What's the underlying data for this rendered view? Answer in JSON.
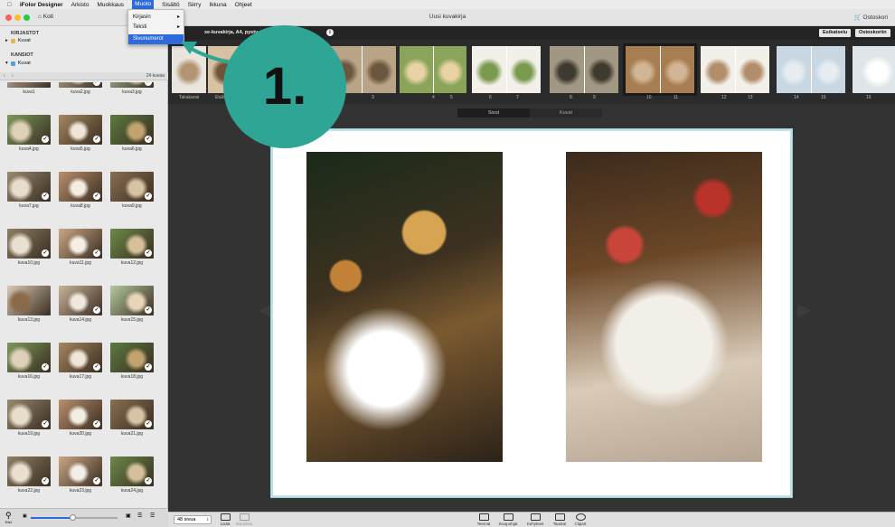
{
  "menubar": {
    "app": "iFolor Designer",
    "items": [
      "Arkisto",
      "Muokkaus",
      "Muoto",
      "Sisältö",
      "Siirry",
      "Ikkuna",
      "Ohjeet"
    ],
    "active": "Muoto"
  },
  "window": {
    "home": "Koti",
    "title": "Uusi kuvakirja",
    "cart": "Ostoskori"
  },
  "dropdown": {
    "items": [
      "Kirjasin",
      "Teksti",
      "Sivunumerot"
    ],
    "highlighted": "Sivunumerot"
  },
  "callout": {
    "label": "1.",
    "color": "#2ea595"
  },
  "sidebar": {
    "libraries_heading": "KIRJASTOT",
    "library_item": "Kuvat",
    "folders_heading": "KANSIOT",
    "folder_item": "Kuvat",
    "count": "24 kuvaa",
    "images": [
      "kuva1",
      "kuva2.jpg",
      "kuva3.jpg",
      "kuva4.jpg",
      "kuva5.jpg",
      "kuva6.jpg",
      "kuva7.jpg",
      "kuva8.jpg",
      "kuva9.jpg",
      "kuva10.jpg",
      "kuva11.jpg",
      "kuva12.jpg",
      "kuva13.jpg",
      "kuva14.jpg",
      "kuva15.jpg",
      "kuva16.jpg",
      "kuva17.jpg",
      "kuva18.jpg",
      "kuva19.jpg",
      "kuva20.jpg",
      "kuva21.jpg",
      "kuva22.jpg",
      "kuva23.jpg",
      "kuva24.jpg"
    ]
  },
  "topbar": {
    "book_info": "xe-kuvakirja, A4, pysty, sis",
    "preview_button": "Esikatselu",
    "cart_button": "Ostoskoriin"
  },
  "page_strip": {
    "labels": [
      "Takakansi",
      "Etuka",
      "3",
      "4",
      "5",
      "6",
      "7",
      "8",
      "9",
      "10",
      "11",
      "12",
      "13",
      "14",
      "15",
      "16"
    ]
  },
  "tabs": {
    "pages": "Sivut",
    "images": "Kuvat",
    "active": "Sivut"
  },
  "bottombar": {
    "page_count": "48 sivua",
    "tools": [
      "Lisää",
      "Muokkaa",
      "Teemat",
      "Sivupohjat",
      "Kehykset",
      "Taustat",
      "Clipart"
    ]
  },
  "colors": {
    "accent": "#2d6bdc",
    "callout": "#2ea595",
    "spread_border": "#bfe3e8"
  }
}
